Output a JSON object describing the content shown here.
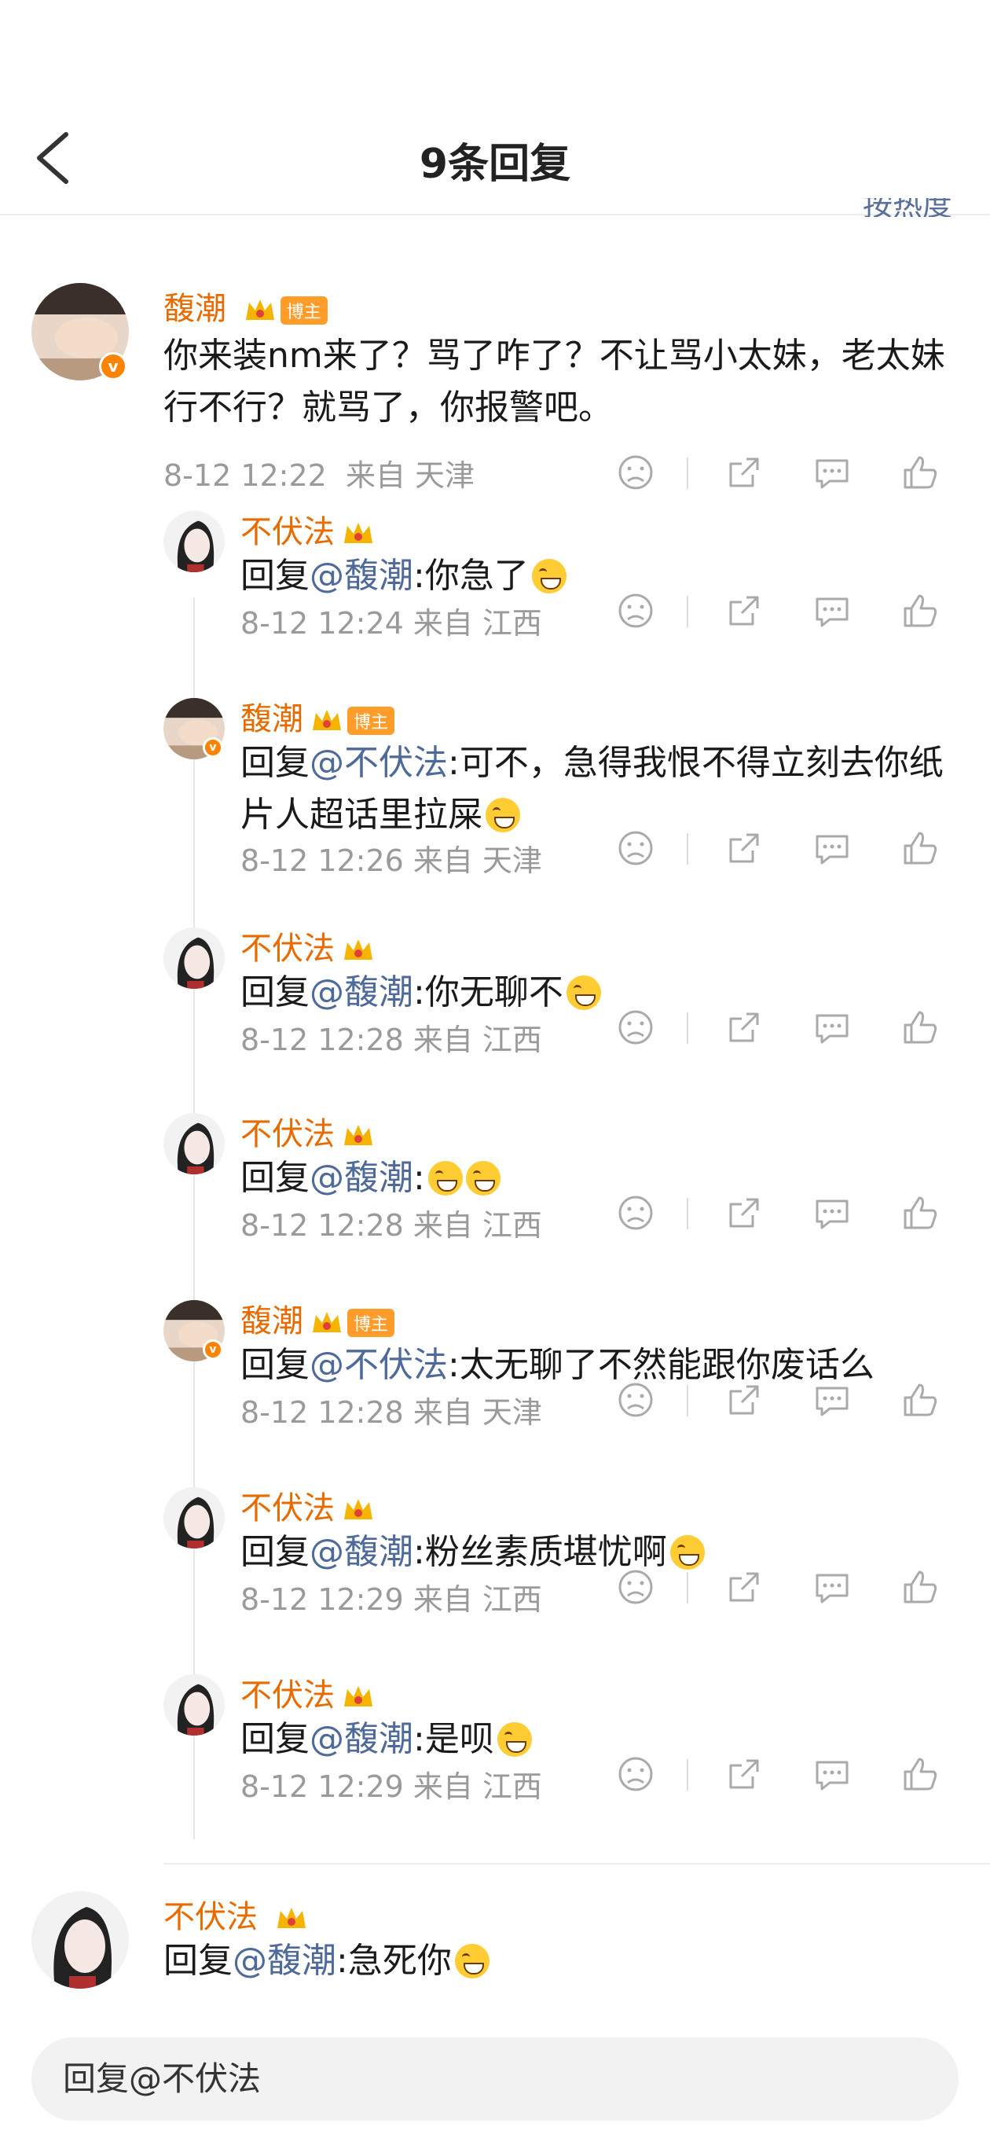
{
  "header": {
    "title": "9条回复",
    "sort_partial": "按热度"
  },
  "main_comment": {
    "user": "馥潮",
    "badge": "博主",
    "text": "你来装nm来了？骂了咋了？不让骂小太妹，老太妹行不行？就骂了，你报警吧。",
    "time": "8-12 12:22",
    "from": "来自 天津"
  },
  "replies": [
    {
      "user": "不伏法",
      "prefix": "回复",
      "mention": "@馥潮",
      "text": ":你急了",
      "time": "8-12 12:24",
      "from": "来自 江西"
    },
    {
      "user": "馥潮",
      "badge": "博主",
      "prefix": "回复",
      "mention": "@不伏法",
      "text": ":可不，急得我恨不得立刻去你纸片人超话里拉屎",
      "time": "8-12 12:26",
      "from": "来自 天津"
    },
    {
      "user": "不伏法",
      "prefix": "回复",
      "mention": "@馥潮",
      "text": ":你无聊不",
      "time": "8-12 12:28",
      "from": "来自 江西"
    },
    {
      "user": "不伏法",
      "prefix": "回复",
      "mention": "@馥潮",
      "text": ":",
      "time": "8-12 12:28",
      "from": "来自 江西"
    },
    {
      "user": "馥潮",
      "badge": "博主",
      "prefix": "回复",
      "mention": "@不伏法",
      "text": ":太无聊了不然能跟你废话么",
      "time": "8-12 12:28",
      "from": "来自 天津"
    },
    {
      "user": "不伏法",
      "prefix": "回复",
      "mention": "@馥潮",
      "text": ":粉丝素质堪忧啊",
      "time": "8-12 12:29",
      "from": "来自 江西"
    },
    {
      "user": "不伏法",
      "prefix": "回复",
      "mention": "@馥潮",
      "text": ":是呗",
      "time": "8-12 12:29",
      "from": "来自 江西"
    }
  ],
  "bottom_comment": {
    "user": "不伏法",
    "prefix": "回复",
    "mention": "@馥潮",
    "text": ":急死你"
  },
  "reply_box": {
    "placeholder": "回复@不伏法"
  },
  "icons": [
    "back-icon",
    "dislike-icon",
    "share-icon",
    "comment-icon",
    "like-icon",
    "crown-icon",
    "verified-icon",
    "emoji-laugh-icon"
  ]
}
